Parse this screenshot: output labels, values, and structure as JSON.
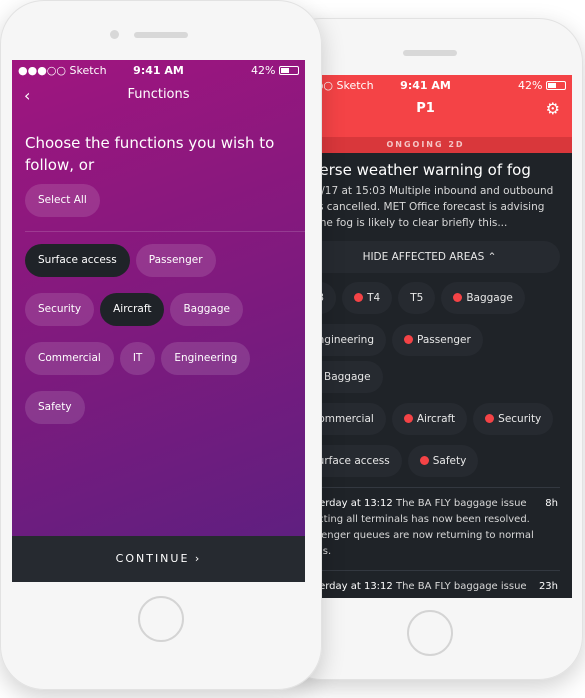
{
  "back_phone": {
    "status": {
      "carrier": "●●●○○ Sketch",
      "time": "9:41 AM",
      "battery": "42%"
    },
    "header": {
      "title": "P1",
      "ongoing": "ONGOING 2D"
    },
    "incident": {
      "title": "Adverse weather warning of fog",
      "description": "12/01/17 at 15:03 Multiple inbound and outbound flights cancelled. MET Office forecast is advising that the fog is likely to clear briefly this..."
    },
    "hide_button": "HIDE AFFECTED AREAS",
    "areas": [
      {
        "label": "T3",
        "alert": false
      },
      {
        "label": "T4",
        "alert": true
      },
      {
        "label": "T5",
        "alert": false
      },
      {
        "label": "Baggage",
        "alert": true
      },
      {
        "label": "Engineering",
        "alert": false
      },
      {
        "label": "Passenger",
        "alert": true
      },
      {
        "label": "Baggage",
        "alert": true
      },
      {
        "label": "Commercial",
        "alert": false
      },
      {
        "label": "Aircraft",
        "alert": true
      },
      {
        "label": "Security",
        "alert": true
      },
      {
        "label": "Surface access",
        "alert": false
      },
      {
        "label": "Safety",
        "alert": true
      }
    ],
    "updates": [
      {
        "time": "Yesterday at 13:12",
        "text": "The BA FLY baggage issue affecting all terminals has now been resolved. Passenger queues are now returning to normal levels.",
        "age": "8h"
      },
      {
        "time": "Yesterday at 13:12",
        "text": "The BA FLY baggage issue",
        "age": "23h"
      }
    ],
    "colors": {
      "accent": "#f44346",
      "bg": "#1f2328"
    }
  },
  "front_phone": {
    "status": {
      "carrier": "●●●○○ Sketch",
      "time": "9:41 AM",
      "battery": "42%"
    },
    "nav": {
      "title": "Functions"
    },
    "prompt": "Choose the functions you wish to follow, or",
    "select_all": "Select All",
    "functions": [
      {
        "label": "Surface access",
        "selected": true
      },
      {
        "label": "Passenger",
        "selected": false
      },
      {
        "label": "Security",
        "selected": false
      },
      {
        "label": "Aircraft",
        "selected": true
      },
      {
        "label": "Baggage",
        "selected": false
      },
      {
        "label": "Commercial",
        "selected": false
      },
      {
        "label": "IT",
        "selected": false
      },
      {
        "label": "Engineering",
        "selected": false
      },
      {
        "label": "Safety",
        "selected": false
      }
    ],
    "continue": "CONTINUE"
  }
}
